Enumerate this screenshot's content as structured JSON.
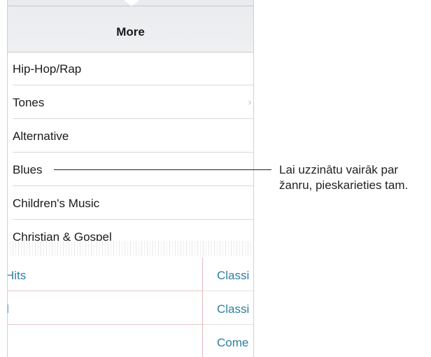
{
  "header": {
    "title": "More"
  },
  "genres": [
    {
      "label": "Hip-Hop/Rap",
      "chevron": false
    },
    {
      "label": "Tones",
      "chevron": true
    },
    {
      "label": "Alternative",
      "chevron": false
    },
    {
      "label": "Blues",
      "chevron": false
    },
    {
      "label": "Children's Music",
      "chevron": false
    },
    {
      "label": "Christian & Gospel",
      "chevron": false
    }
  ],
  "lower_left": [
    "Hits",
    "l",
    ""
  ],
  "lower_right": [
    "Classi",
    "Classi",
    "Come"
  ],
  "callout": {
    "line1": "Lai uzzinātu vairāk par",
    "line2": "žanru, pieskarieties tam."
  },
  "icons": {
    "chevron": "chevron-right-icon"
  },
  "colors": {
    "link": "#2d7fa1",
    "header_bg": "#eceef1"
  }
}
